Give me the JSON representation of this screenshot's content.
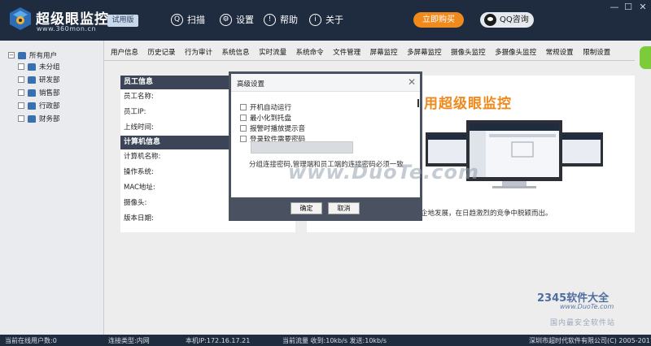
{
  "app": {
    "title": "超级眼监控",
    "url": "www.360mon.cn",
    "trial_badge": "试用版"
  },
  "topnav": [
    {
      "icon": "scan-icon",
      "glyph": "Q",
      "label": "扫描"
    },
    {
      "icon": "gear-icon",
      "glyph": "⚙",
      "label": "设置"
    },
    {
      "icon": "help-icon",
      "glyph": "!",
      "label": "帮助"
    },
    {
      "icon": "info-icon",
      "glyph": "i",
      "label": "关于"
    }
  ],
  "buy_label": "立即购买",
  "qq_label": "QQ咨询",
  "window_controls": {
    "minimize": "—",
    "maximize": "☐",
    "close": "✕"
  },
  "sidebar": {
    "root": "所有用户",
    "items": [
      "未分组",
      "研发部",
      "销售部",
      "行政部",
      "财务部"
    ]
  },
  "tabs": [
    "用户信息",
    "历史记录",
    "行为审计",
    "系统信息",
    "实时流量",
    "系统命令",
    "文件管理",
    "屏幕监控",
    "多屏幕监控",
    "摄像头监控",
    "多摄像头监控",
    "常规设置",
    "限制设置"
  ],
  "employee_panel": {
    "header": "员工信息",
    "rows": [
      "员工名称:",
      "员工IP:",
      "上线时间:"
    ],
    "computer_header": "计算机信息",
    "computer_rows": [
      "计算机名称:",
      "操作系统:",
      "MAC地址:",
      "摄像头:",
      "版本日期:"
    ]
  },
  "promo": {
    "title": "用超级眼监控",
    "desc": "企地发展，在日趋激烈的竞争中脱颖而出。"
  },
  "modal": {
    "title": "高级设置",
    "options": [
      "开机自动运行",
      "最小化到托盘",
      "报警时播放提示音",
      "登录软件需要密码"
    ],
    "hint": "分组连接密码,管理端和员工端的连接密码必须一致",
    "ok_label": "确定",
    "cancel_label": "取消"
  },
  "watermarks": {
    "duote": "www.DuoTe.com",
    "brand": "2345软件大全",
    "url": "www.DuoTe.com",
    "safe": "国内最安全软件站"
  },
  "statusbar": {
    "online": "当前在线用户数:0",
    "conn_type": "连接类型:内网",
    "ip": "本机IP:172.16.17.21",
    "traffic": "当前流量 收到:10kb/s    发送:10kb/s",
    "copyright": "深圳市超时代软件有限公司(C) 2005-2017"
  },
  "colors": {
    "topbar": "#1f2c3f",
    "accent": "#f08a1c",
    "panel_header": "#3b4557"
  }
}
